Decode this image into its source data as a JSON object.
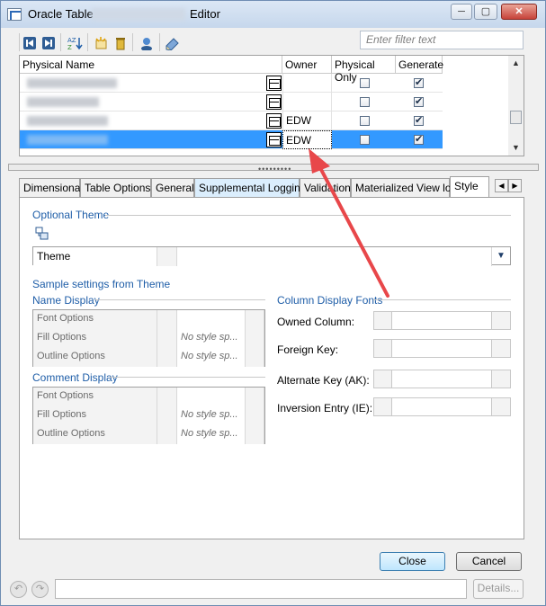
{
  "window": {
    "title_prefix": "Oracle Table",
    "title_suffix": "Editor",
    "controls": {
      "minimize": "─",
      "maximize": "▢",
      "close": "✕"
    }
  },
  "toolbar": {
    "icons": [
      "first-record-icon",
      "next-record-icon",
      "sort-az-icon",
      "new-item-icon",
      "delete-icon",
      "user-icon",
      "edit-icon"
    ],
    "filter_placeholder": "Enter filter text"
  },
  "table": {
    "columns": [
      "Physical Name",
      "Owner",
      "Physical Only",
      "Generate"
    ],
    "rows": [
      {
        "owner": "",
        "physical_only": false,
        "generate": true,
        "selected": false
      },
      {
        "owner": "",
        "physical_only": false,
        "generate": true,
        "selected": false
      },
      {
        "owner": "EDW",
        "physical_only": false,
        "generate": true,
        "selected": false
      },
      {
        "owner": "EDW",
        "physical_only": false,
        "generate": true,
        "selected": true
      }
    ]
  },
  "tabs": [
    "Dimensional",
    "Table Options",
    "General",
    "Supplemental Logging",
    "Validation",
    "Materialized View log",
    "Style"
  ],
  "active_tab": "Style",
  "style_panel": {
    "optional_theme_title": "Optional Theme",
    "theme_label": "Theme",
    "theme_value": "",
    "sample_settings_title": "Sample settings from Theme",
    "name_display": {
      "title": "Name Display",
      "rows": [
        {
          "label": "Font Options",
          "value": ""
        },
        {
          "label": "Fill Options",
          "value": "No style sp..."
        },
        {
          "label": "Outline Options",
          "value": "No style sp..."
        }
      ]
    },
    "comment_display": {
      "title": "Comment Display",
      "rows": [
        {
          "label": "Font Options",
          "value": ""
        },
        {
          "label": "Fill Options",
          "value": "No style sp..."
        },
        {
          "label": "Outline Options",
          "value": "No style sp..."
        }
      ]
    },
    "column_display_fonts": {
      "title": "Column Display Fonts",
      "rows": [
        {
          "label": "Owned Column:"
        },
        {
          "label": "Foreign Key:"
        },
        {
          "label": "Alternate Key (AK):"
        },
        {
          "label": "Inversion Entry (IE):"
        }
      ]
    }
  },
  "buttons": {
    "close": "Close",
    "cancel": "Cancel",
    "details": "Details..."
  },
  "colors": {
    "selection": "#3399ff",
    "section_title": "#1f5ea8",
    "annotation_arrow": "#e8474a"
  }
}
